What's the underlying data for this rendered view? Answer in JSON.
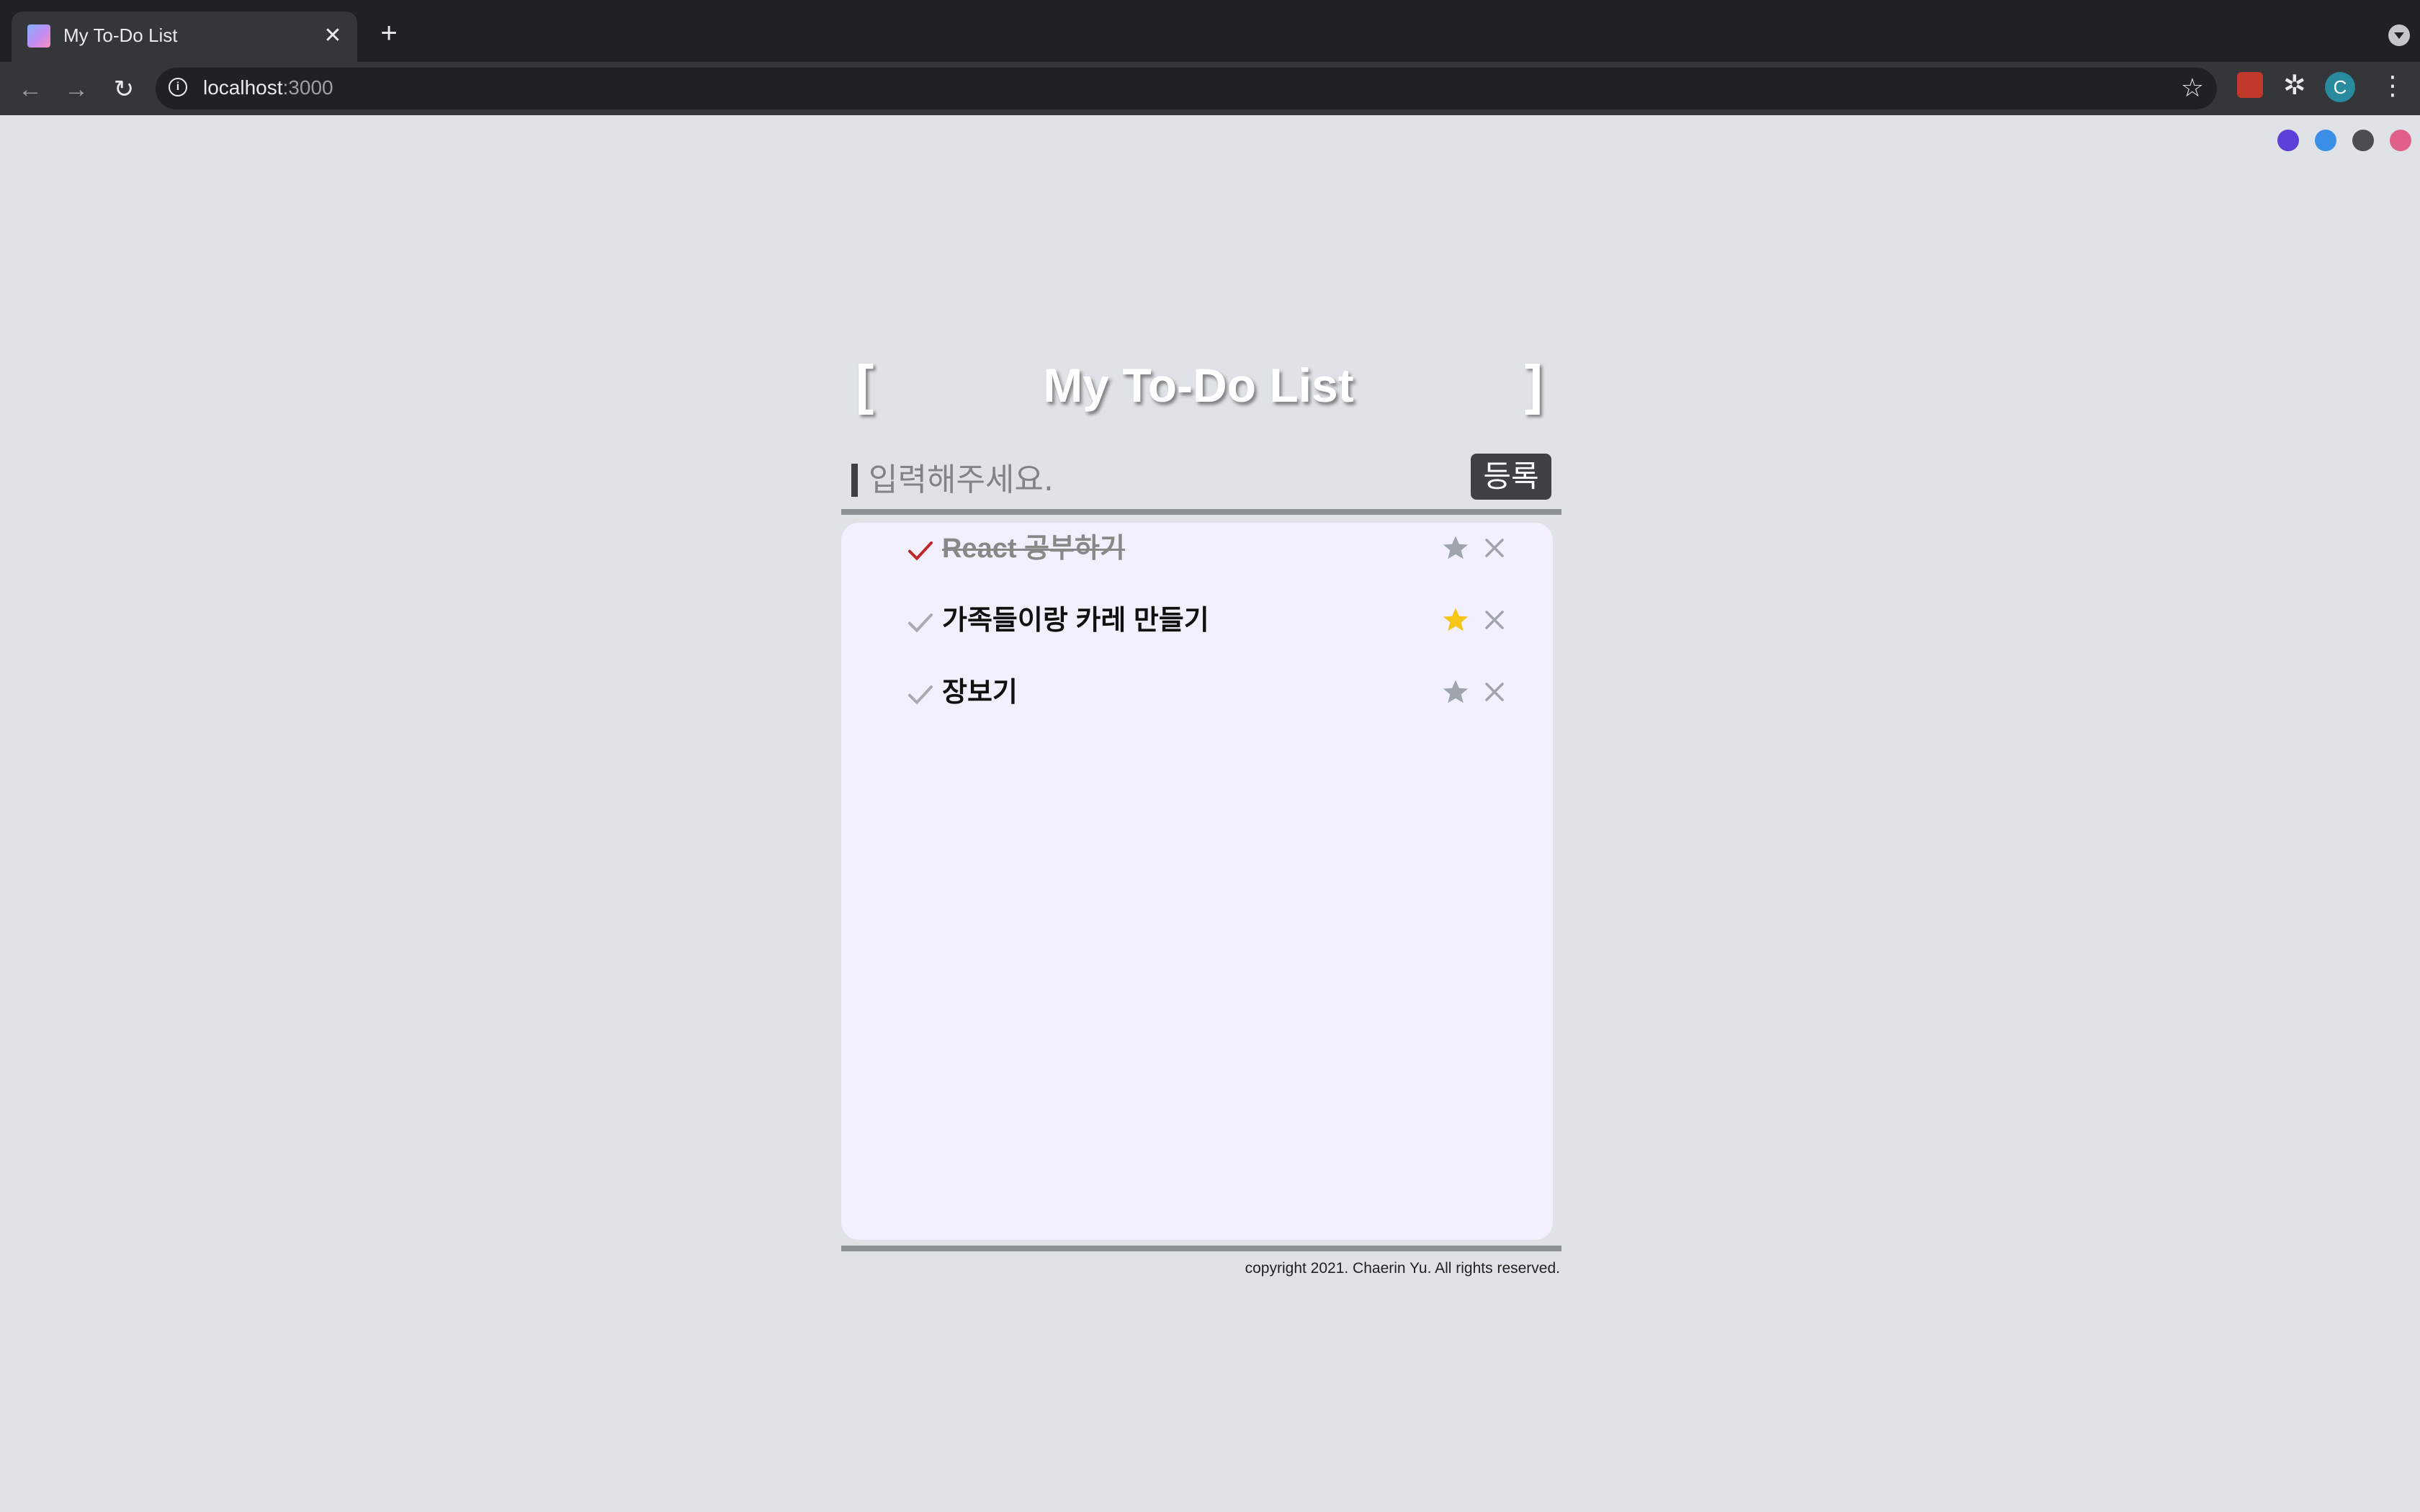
{
  "browser": {
    "tab_title": "My To-Do List",
    "tab_close": "✕",
    "new_tab": "+",
    "url_host": "localhost",
    "url_port": ":3000",
    "profile_initial": "C"
  },
  "theme_colors": [
    "#5b3fd6",
    "#3a8ee6",
    "#4a4d52",
    "#e0608a"
  ],
  "app": {
    "bracket_left": "[",
    "bracket_right": "]",
    "title": "My To-Do List",
    "input_placeholder": "입력해주세요.",
    "submit_label": "등록",
    "todos": [
      {
        "text": "React 공부하기",
        "done": true,
        "starred": false
      },
      {
        "text": "가족들이랑 카레 만들기",
        "done": false,
        "starred": true
      },
      {
        "text": "장보기",
        "done": false,
        "starred": false
      }
    ],
    "footer": "copyright 2021. Chaerin Yu. All rights reserved.",
    "colors": {
      "check_done": "#c0272d",
      "check_idle": "#a9abb0",
      "star_active": "#f5c518",
      "star_idle": "#a0a4ab",
      "delete": "#a0a4ab"
    }
  }
}
